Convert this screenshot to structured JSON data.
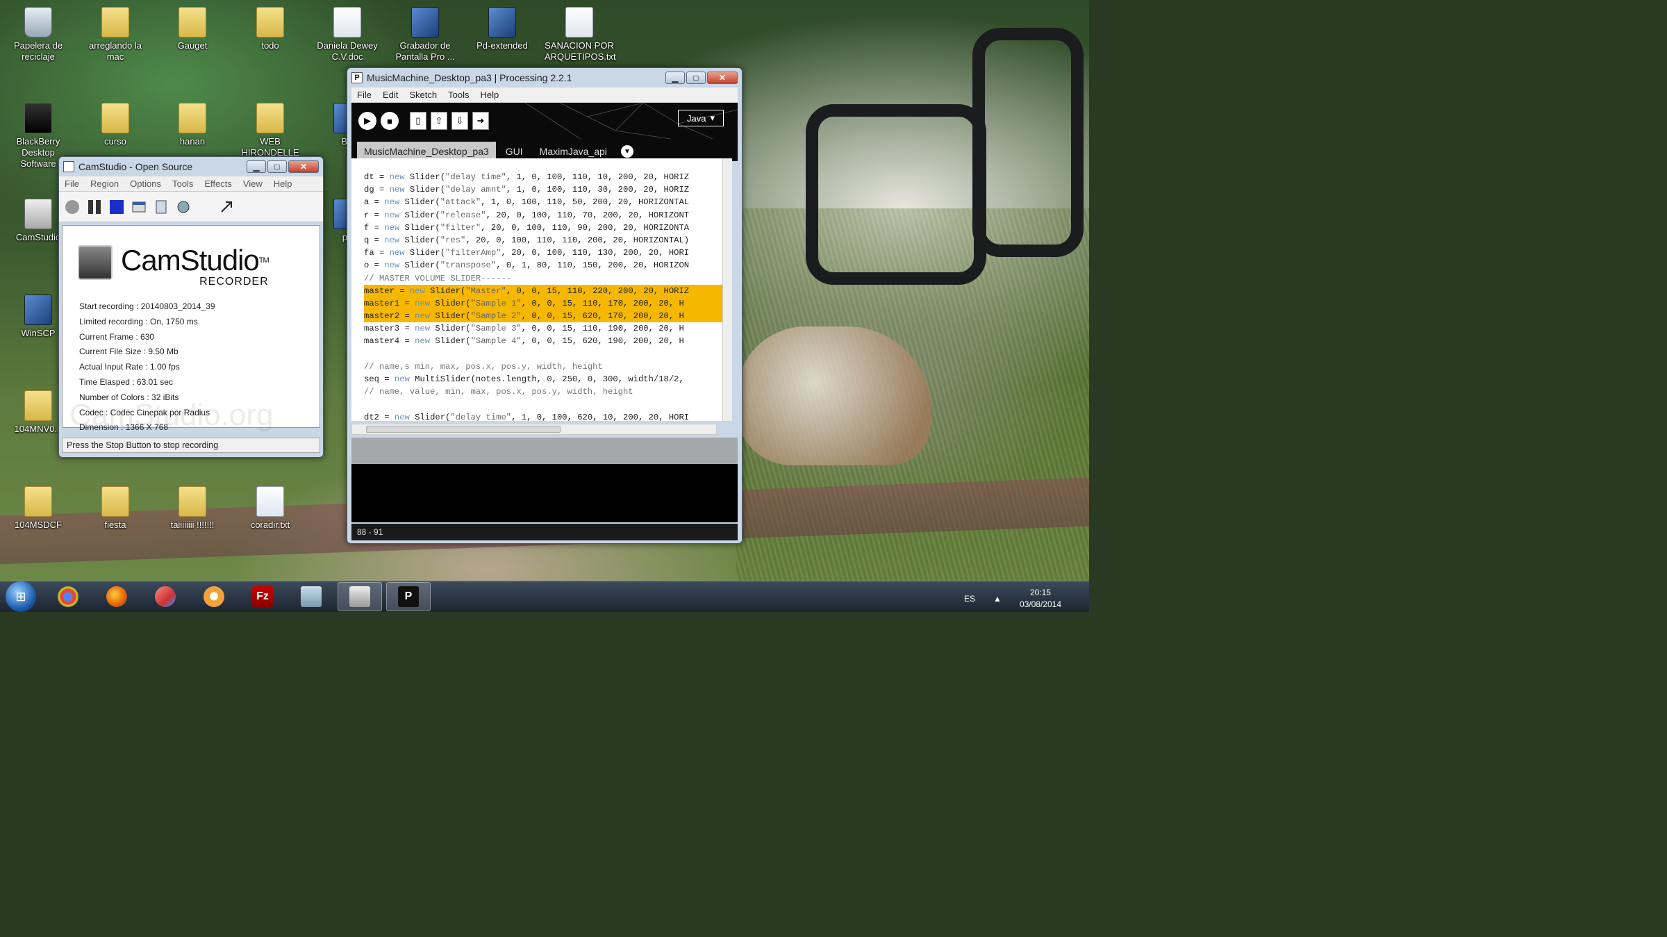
{
  "desktop": {
    "icons": [
      {
        "label": "Papelera de reciclaje",
        "kind": "recycle-bin-icon"
      },
      {
        "label": "arreglando la mac",
        "kind": "folder-icon"
      },
      {
        "label": "Gauget",
        "kind": "folder-icon"
      },
      {
        "label": "todo",
        "kind": "folder-icon"
      },
      {
        "label": "Daniela Dewey C.V.doc",
        "kind": "document-icon"
      },
      {
        "label": "Grabador de Pantalla Pro ...",
        "kind": "app-icon"
      },
      {
        "label": "Pd-extended",
        "kind": "app-icon"
      },
      {
        "label": "SANACION POR ARQUETIPOS.txt",
        "kind": "document-icon"
      },
      {
        "label": "BlackBerry Desktop Software",
        "kind": "blackberry-icon"
      },
      {
        "label": "curso",
        "kind": "folder-icon"
      },
      {
        "label": "hanan",
        "kind": "folder-icon"
      },
      {
        "label": "WEB HIRONDELLE",
        "kind": "folder-icon"
      },
      {
        "label": "BB",
        "kind": "app-icon"
      },
      {
        "label": "CamStudio",
        "kind": "camstudio-icon"
      },
      {
        "label": "pd",
        "kind": "app-icon"
      },
      {
        "label": "WinSCP",
        "kind": "winscp-icon"
      },
      {
        "label": "104MNV0...",
        "kind": "folder-icon"
      },
      {
        "label": "104MSDCF",
        "kind": "folder-icon"
      },
      {
        "label": "fiesta",
        "kind": "folder-icon"
      },
      {
        "label": "taiiiiiiii !!!!!!!",
        "kind": "folder-icon"
      },
      {
        "label": "coradir.txt",
        "kind": "document-icon"
      }
    ]
  },
  "camstudio": {
    "title": "CamStudio - Open Source",
    "menu": [
      "File",
      "Region",
      "Options",
      "Tools",
      "Effects",
      "View",
      "Help"
    ],
    "logo_name": "CamStudio",
    "logo_tm": "TM",
    "logo_sub": "RECORDER",
    "info": [
      "Start recording : 20140803_2014_39",
      "Limited recording : On, 1750 ms.",
      "Current Frame : 630",
      "Current File Size : 9.50 Mb",
      "Actual Input Rate : 1.00 fps",
      "Time Elasped : 63.01 sec",
      "Number of Colors : 32 iBits",
      "Codec : Codec Cinepak por Radius",
      "Dimension : 1366 X 768"
    ],
    "watermark": "CamStudio.org",
    "status": "Press the Stop Button to stop recording"
  },
  "processing": {
    "title": "MusicMachine_Desktop_pa3 | Processing 2.2.1",
    "menu": [
      "File",
      "Edit",
      "Sketch",
      "Tools",
      "Help"
    ],
    "mode": "Java",
    "tabs": [
      "MusicMachine_Desktop_pa3",
      "GUI",
      "MaximJava_api"
    ],
    "code_lines": [
      {
        "text": "dt = new Slider(\"delay time\", 1, 0, 100, 110, 10, 200, 20, HORIZ",
        "hl": false
      },
      {
        "text": "dg = new Slider(\"delay amnt\", 1, 0, 100, 110, 30, 200, 20, HORIZ",
        "hl": false
      },
      {
        "text": "a = new Slider(\"attack\", 1, 0, 100, 110, 50, 200, 20, HORIZONTAL",
        "hl": false
      },
      {
        "text": "r = new Slider(\"release\", 20, 0, 100, 110, 70, 200, 20, HORIZONT",
        "hl": false
      },
      {
        "text": "f = new Slider(\"filter\", 20, 0, 100, 110, 90, 200, 20, HORIZONTA",
        "hl": false
      },
      {
        "text": "q = new Slider(\"res\", 20, 0, 100, 110, 110, 200, 20, HORIZONTAL)",
        "hl": false
      },
      {
        "text": "fa = new Slider(\"filterAmp\", 20, 0, 100, 110, 130, 200, 20, HORI",
        "hl": false
      },
      {
        "text": "o = new Slider(\"transpose\", 0, 1, 80, 110, 150, 200, 20, HORIZON",
        "hl": false
      },
      {
        "text": "// MASTER VOLUME SLIDER------",
        "hl": false
      },
      {
        "text": "master = new Slider(\"Master\", 0, 0, 15, 110, 220, 200, 20, HORIZ",
        "hl": true
      },
      {
        "text": "master1 = new Slider(\"Sample 1\", 0, 0, 15, 110, 170, 200, 20, H",
        "hl": true
      },
      {
        "text": "master2 = new Slider(\"Sample 2\", 0, 0, 15, 620, 170, 200, 20, H",
        "hl": true
      },
      {
        "text": "master3 = new Slider(\"Sample 3\", 0, 0, 15, 110, 190, 200, 20, H",
        "hl": false
      },
      {
        "text": "master4 = new Slider(\"Sample 4\", 0, 0, 15, 620, 190, 200, 20, H",
        "hl": false
      },
      {
        "text": "",
        "hl": false
      },
      {
        "text": "// name,s min, max, pos.x, pos.y, width, height",
        "hl": false
      },
      {
        "text": "seq = new MultiSlider(notes.length, 0, 250, 0, 300, width/18/2,",
        "hl": false
      },
      {
        "text": "// name, value, min, max, pos.x, pos.y, width, height",
        "hl": false
      },
      {
        "text": "",
        "hl": false
      },
      {
        "text": "dt2 = new Slider(\"delay time\", 1, 0, 100, 620, 10, 200, 20, HORI",
        "hl": false
      }
    ],
    "line_status": "88 - 91"
  },
  "taskbar": {
    "apps": [
      "chrome-icon",
      "firefox-icon",
      "mozilla-icon",
      "settings-gear-icon",
      "filezilla-icon",
      "explorer-icon",
      "camstudio-icon",
      "processing-icon"
    ],
    "lang": "ES",
    "time": "20:15",
    "date": "03/08/2014"
  }
}
